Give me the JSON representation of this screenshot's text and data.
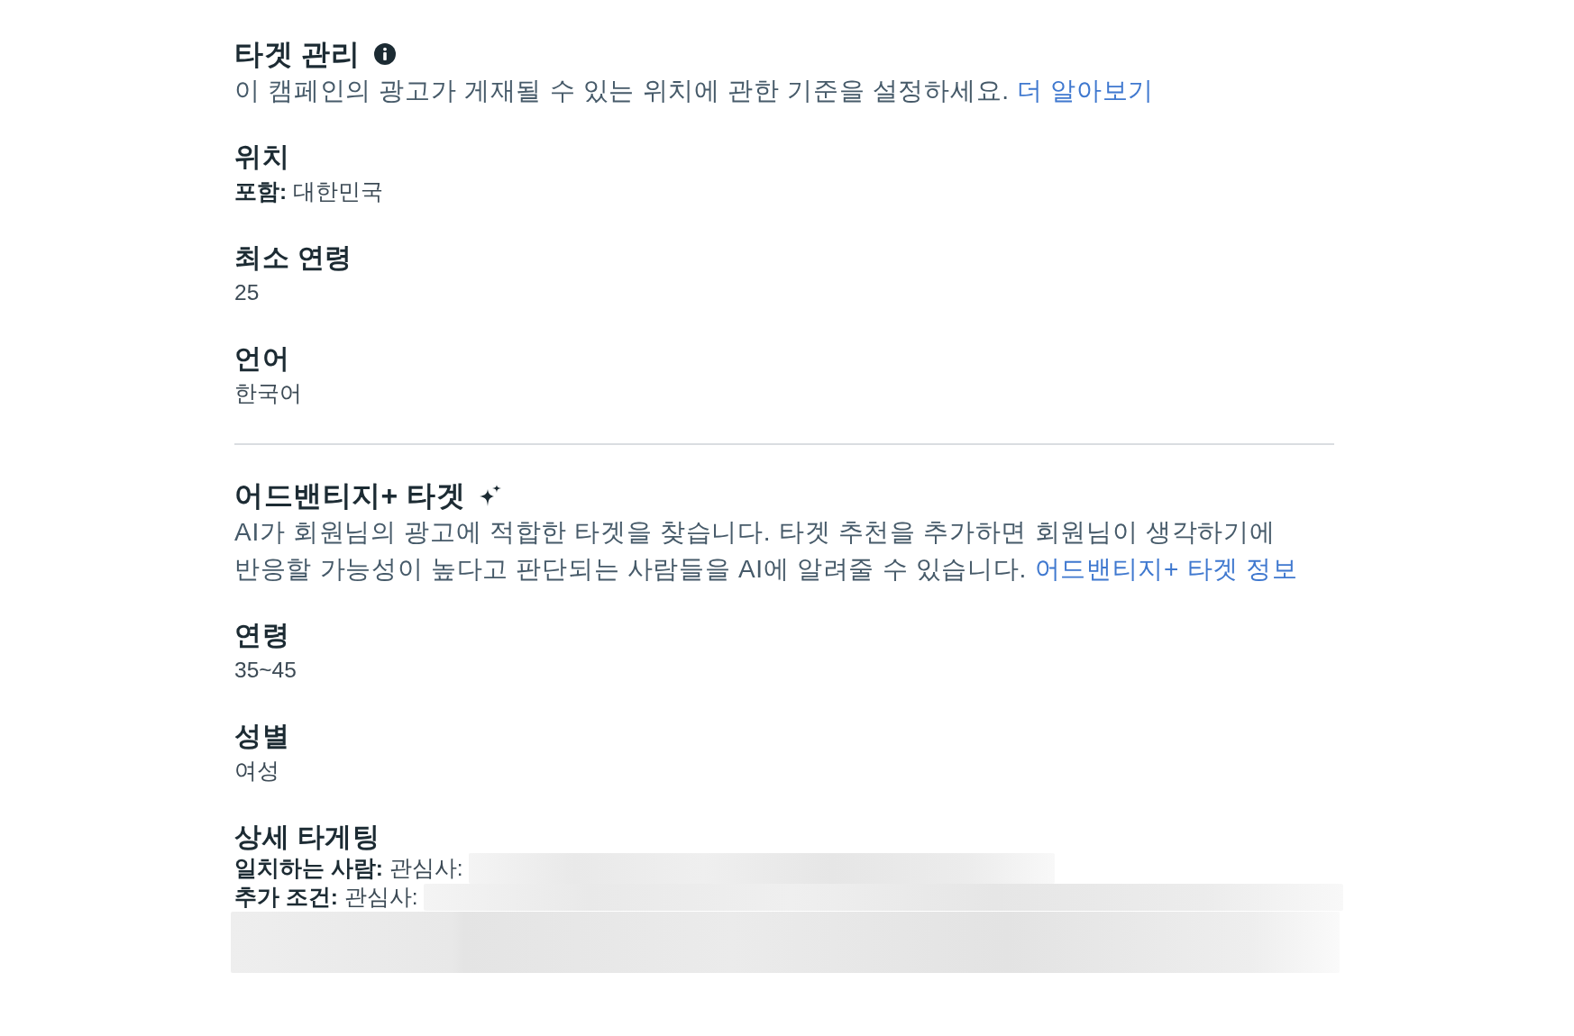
{
  "sections": [
    {
      "kind": "manual",
      "title": "타겟 관리",
      "description": "이 캠페인의 광고가 게재될 수 있는 위치에 관한 기준을 설정하세요.",
      "link": "더 알아보기",
      "fields": [
        {
          "kind": "text",
          "label": "위치",
          "lines": [
            "**포함:** 대한민국"
          ]
        },
        {
          "kind": "text",
          "label": "최소 연령",
          "lines": [
            "25"
          ]
        },
        {
          "kind": "text",
          "label": "언어",
          "lines": [
            "한국어"
          ]
        }
      ]
    },
    {
      "kind": "ai",
      "title": "어드밴티지+ 타겟",
      "description": "AI가 회원님의 광고에 적합한 타겟을 찾습니다. 타겟 추천을 추가하면 회원님이 생각하기에 반응할 가능성이 높다고 판단되는 사람들을 AI에 알려줄 수 있습니다.",
      "link": "어드밴티지+ 타겟 정보",
      "fields": [
        {
          "kind": "text",
          "label": "연령",
          "lines": [
            "35~45"
          ]
        },
        {
          "kind": "text",
          "label": "성별",
          "lines": [
            "여성"
          ]
        },
        {
          "kind": "blurred",
          "label": "상세 타게팅",
          "lines": [
            "**일치하는 사람:** 관심사:",
            "**추가 조건:** 관심사:"
          ]
        }
      ]
    }
  ]
}
